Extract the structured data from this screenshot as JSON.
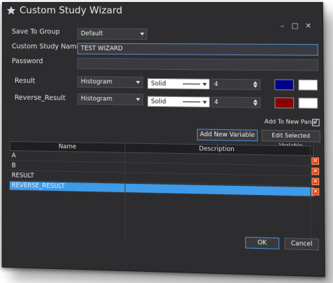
{
  "window": {
    "title": "Custom Study Wizard",
    "controls": {
      "minimize": "–",
      "maximize": "□",
      "close": "✕"
    }
  },
  "form": {
    "save_to_group": {
      "label": "Save To Group",
      "value": "Default"
    },
    "study_name": {
      "label": "Custom Study Name",
      "value": "TEST WIZARD"
    },
    "password": {
      "label": "Password",
      "value": ""
    },
    "variables": [
      {
        "name": "Result",
        "plot_type": "Histogram",
        "line_style": "Solid",
        "width": "4",
        "color1": "#00008b",
        "color2": "#ffffff"
      },
      {
        "name": "Reverse_Result",
        "plot_type": "Histogram",
        "line_style": "Solid",
        "width": "4",
        "color1": "#8b0000",
        "color2": "#ffffff"
      }
    ],
    "add_to_new_panel": {
      "label": "Add To New Panel",
      "checked": true,
      "check_mark": "✓"
    }
  },
  "buttons": {
    "add_variable": "Add New Variable",
    "edit_variable": "Edit Selected Variable",
    "ok": "OK",
    "cancel": "Cancel"
  },
  "grid": {
    "columns": [
      "Name",
      "Description"
    ],
    "rows": [
      {
        "name": "A",
        "description": ""
      },
      {
        "name": "B",
        "description": ""
      },
      {
        "name": "RESULT",
        "description": ""
      },
      {
        "name": "REVERSE_RESULT",
        "description": "",
        "selected": true
      }
    ],
    "delete_glyph": "✕"
  },
  "colors": {
    "accent": "#3d9be9",
    "delete": "#e0451b",
    "window_bg": "#2d2d30"
  }
}
